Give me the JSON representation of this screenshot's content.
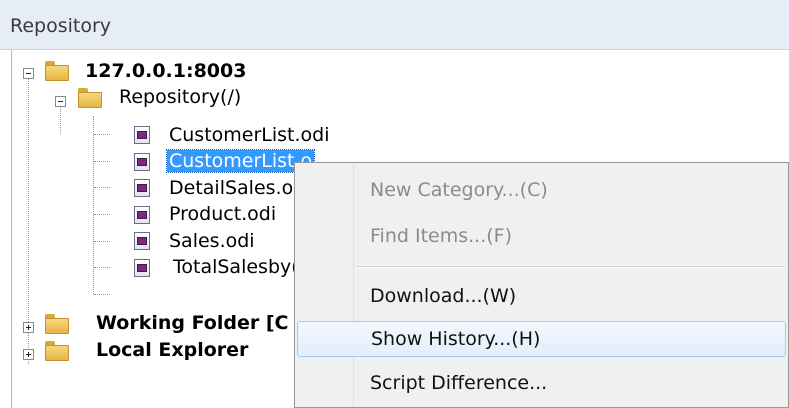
{
  "panel": {
    "title": "Repository"
  },
  "tree": {
    "root": {
      "label": "127.0.0.1:8003"
    },
    "repository": {
      "label": "Repository(/)"
    },
    "files": [
      {
        "label": "CustomerList.odi"
      },
      {
        "label": "CustomerList.o"
      },
      {
        "label": "DetailSales.oz"
      },
      {
        "label": "Product.odi"
      },
      {
        "label": "Sales.odi"
      },
      {
        "label": "TotalSalesby("
      }
    ],
    "working_folder": {
      "label": "Working Folder [C"
    },
    "local_explorer": {
      "label": "Local Explorer"
    }
  },
  "context_menu": {
    "items": [
      {
        "label": "New Category...(C)",
        "enabled": false
      },
      {
        "label": "Find Items...(F)",
        "enabled": false
      },
      {
        "label": "Download...(W)",
        "enabled": true
      },
      {
        "label": "Show History...(H)",
        "enabled": true
      },
      {
        "label": "Script Difference...",
        "enabled": true
      }
    ]
  },
  "colors": {
    "selection": "#3399ff",
    "header_bg": "#e6edf7",
    "menu_bg": "#f0f0f0",
    "menu_hover_border": "#a8c8ee"
  }
}
